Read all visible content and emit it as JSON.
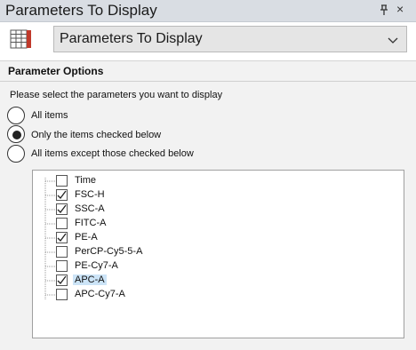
{
  "titlebar": {
    "title": "Parameters To Display",
    "pin_icon": "pin-icon",
    "close_glyph": "×"
  },
  "header": {
    "icon": "grid-table-icon",
    "select_value": "Parameters To Display"
  },
  "section": {
    "title": "Parameter Options"
  },
  "prompt": "Please select the parameters you want to display",
  "radios": [
    {
      "label": "All items",
      "selected": false
    },
    {
      "label": "Only the items checked below",
      "selected": true
    },
    {
      "label": "All items except those checked below",
      "selected": false
    }
  ],
  "parameters": [
    {
      "label": "Time",
      "checked": false
    },
    {
      "label": "FSC-H",
      "checked": true
    },
    {
      "label": "SSC-A",
      "checked": true
    },
    {
      "label": "FITC-A",
      "checked": false
    },
    {
      "label": "PE-A",
      "checked": true
    },
    {
      "label": "PerCP-Cy5-5-A",
      "checked": false
    },
    {
      "label": "PE-Cy7-A",
      "checked": false
    },
    {
      "label": "APC-A",
      "checked": true,
      "selected": true
    },
    {
      "label": "APC-Cy7-A",
      "checked": false
    }
  ],
  "colors": {
    "titlebar": "#d9dde3",
    "selection": "#cce4f7",
    "section_bg": "#f2f2f2",
    "icon_red": "#c0392b"
  }
}
